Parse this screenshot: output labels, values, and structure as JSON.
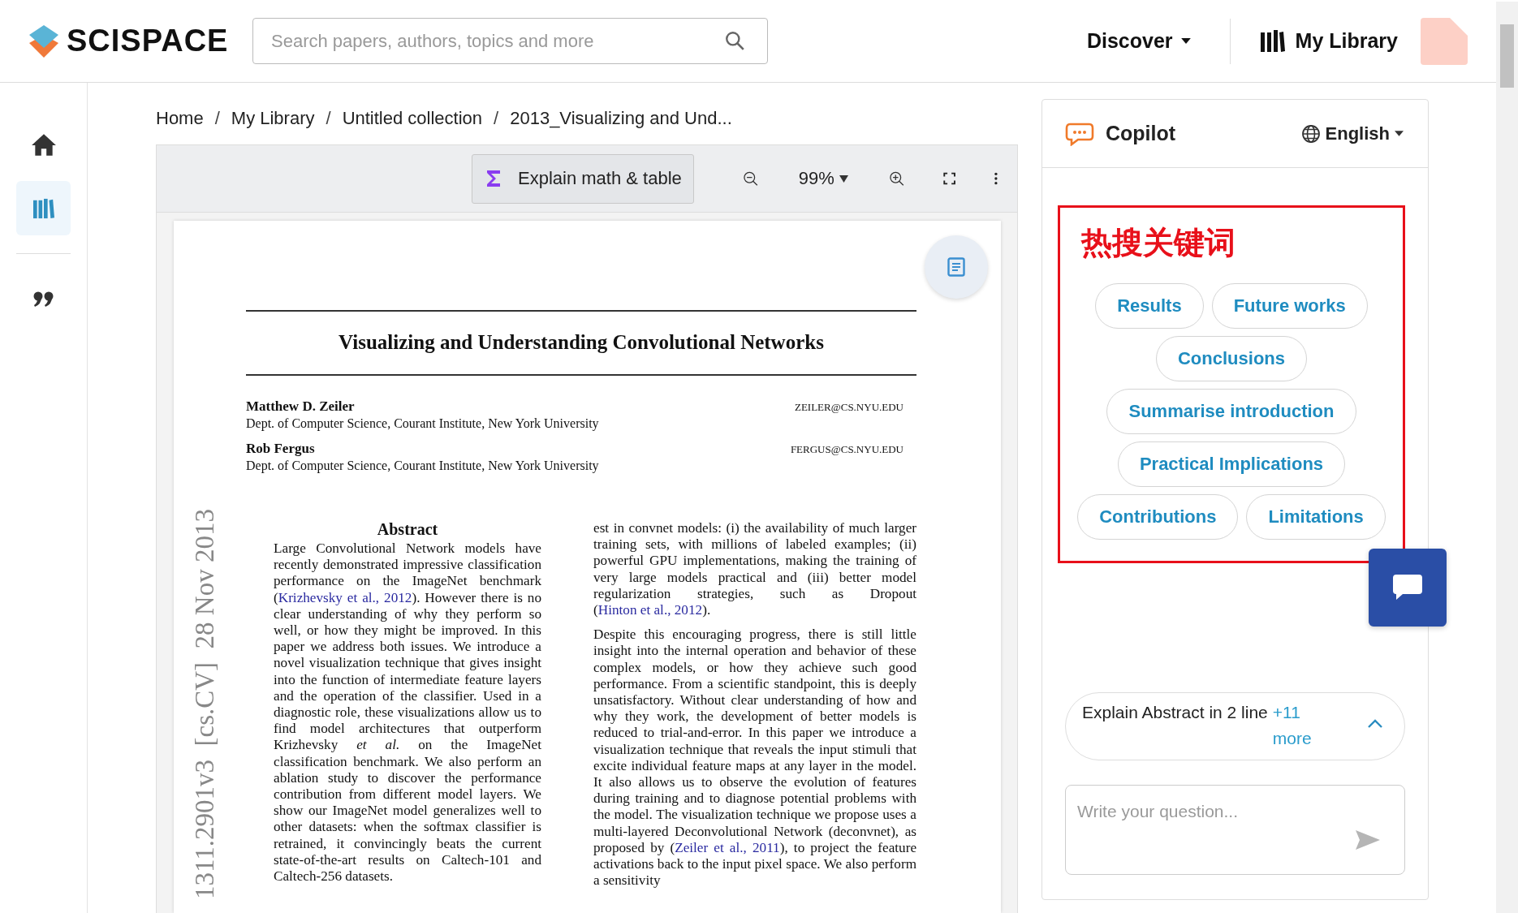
{
  "header": {
    "logo_text": "SCISPACE",
    "search": {
      "placeholder": "Search papers, authors, topics and more"
    },
    "discover": "Discover",
    "library": "My Library"
  },
  "sidebar": {
    "items": [
      {
        "kind": "home",
        "selected": false
      },
      {
        "kind": "library",
        "selected": true
      },
      {
        "kind": "quote",
        "selected": false
      }
    ]
  },
  "breadcrumb_separator": "/",
  "breadcrumb": [
    "Home",
    "My Library",
    "Untitled collection",
    "2013_Visualizing and Und..."
  ],
  "toolbar": {
    "explain_button": "Explain math & table",
    "zoom": "99%"
  },
  "paper": {
    "title": "Visualizing and Understanding Convolutional Networks",
    "authors": [
      {
        "name": "Matthew D. Zeiler",
        "email": "ZEILER@CS.NYU.EDU",
        "affiliation": "Dept. of Computer Science, Courant Institute, New York University"
      },
      {
        "name": "Rob Fergus",
        "email": "FERGUS@CS.NYU.EDU",
        "affiliation": "Dept. of Computer Science, Courant Institute, New York University"
      }
    ],
    "side_stamp": "1311.2901v3  [cs.CV]  28 Nov 2013",
    "abstract_heading": "Abstract",
    "left_paragraphs": [
      [
        {
          "kind": "plain",
          "text": "Large Convolutional Network models have recently demonstrated impressive classification performance on the ImageNet benchmark ("
        },
        {
          "kind": "cite",
          "text": "Krizhevsky et al., 2012"
        },
        {
          "kind": "plain",
          "text": "). However there is no clear understanding of why they perform so well, or how they might be improved. In this paper we address both issues. We introduce a novel visualization technique that gives insight into the function of intermediate feature layers and the operation of the classifier. Used in a diagnostic role, these visualizations allow us to find model architectures that outperform Krizhevsky "
        },
        {
          "kind": "italic",
          "text": "et al."
        },
        {
          "kind": "plain",
          "text": " on the ImageNet classification benchmark. We also perform an ablation study to discover the performance contribution from different model layers. We show our ImageNet model generalizes well to other datasets: when the softmax classifier is retrained, it convincingly beats the current state-of-the-art results on Caltech-101 and Caltech-256 datasets."
        }
      ]
    ],
    "right_paragraphs": [
      [
        {
          "kind": "plain",
          "text": "est in convnet models: (i) the availability of much larger training sets, with millions of labeled examples; (ii) powerful GPU implementations, making the training of very large models practical and (iii) better model regularization strategies, such as Dropout ("
        },
        {
          "kind": "cite",
          "text": "Hinton et al., 2012"
        },
        {
          "kind": "plain",
          "text": ")."
        }
      ],
      [
        {
          "kind": "plain",
          "text": "Despite this encouraging progress, there is still little insight into the internal operation and behavior of these complex models, or how they achieve such good performance. From a scientific standpoint, this is deeply unsatisfactory. Without clear understanding of how and why they work, the development of better models is reduced to trial-and-error. In this paper we introduce a visualization technique that reveals the input stimuli that excite individual feature maps at any layer in the model. It also allows us to observe the evolution of features during training and to diagnose potential problems with the model. The visualization technique we propose uses a multi-layered Deconvolutional Network (deconvnet), as proposed by ("
        },
        {
          "kind": "cite",
          "text": "Zeiler et al., 2011"
        },
        {
          "kind": "plain",
          "text": "), to project the feature activations back to the input pixel space. We also perform a sensitivity"
        }
      ]
    ]
  },
  "copilot": {
    "title": "Copilot",
    "language": "English",
    "annotation": "热搜关键词",
    "chips": [
      "Results",
      "Future works",
      "Conclusions",
      "Summarise introduction",
      "Practical Implications",
      "Contributions",
      "Limitations"
    ],
    "suggestion": "Explain Abstract in 2 line",
    "more": "+11 more",
    "expanded": true,
    "input": {
      "placeholder": "Write your question..."
    }
  }
}
